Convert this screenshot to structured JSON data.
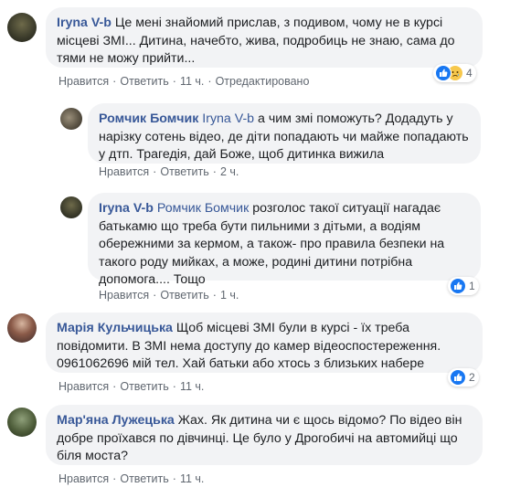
{
  "comments": [
    {
      "author": "Iryna V-b",
      "text": "Це мені знайомий прислав, з подивом, чому не в курсі місцеві ЗМІ... Дитина, начебто, жива, подробиць не знаю, сама до тями не можу прийти...",
      "actions": {
        "like": "Нравится",
        "reply": "Ответить",
        "time": "11 ч.",
        "edited": "Отредактировано"
      },
      "reaction_count": "4",
      "reactions": [
        "like-icon",
        "sad-icon"
      ]
    },
    {
      "author": "Ромчик Бомчик",
      "mention": "Iryna V-b",
      "text": "а чим змі поможуть? Додадуть у нарізку сотень відео, де діти попадають чи майже попадають у дтп. Трагедія, дай Боже, щоб дитинка вижила",
      "actions": {
        "like": "Нравится",
        "reply": "Ответить",
        "time": "2 ч."
      }
    },
    {
      "author": "Iryna V-b",
      "mention": "Ромчик Бомчик",
      "text": "розголос такої ситуації нагадає батькамю що треба бути пильними з дітьми, а водіям обережними за кермом, а також- про правила безпеки на такого роду мийках, а може, родині дитини потрібна допомога.... Тощо",
      "actions": {
        "like": "Нравится",
        "reply": "Ответить",
        "time": "1 ч."
      },
      "reaction_count": "1",
      "reactions": [
        "like-icon"
      ]
    },
    {
      "author": "Марія Кульчицька",
      "text": "Щоб місцеві ЗМІ були в курсі - їх треба повідомити. В ЗМІ нема доступу до камер відеоспостереження. 0961062696 мій тел. Хай батьки або хтось з близьких наберe",
      "actions": {
        "like": "Нравится",
        "reply": "Ответить",
        "time": "11 ч."
      },
      "reaction_count": "2",
      "reactions": [
        "like-icon"
      ]
    },
    {
      "author": "Мар'яна Лужецька",
      "text": "Жах. Як дитина чи є щось відомо? По відео він добре проїхався по дівчинці. Це було у Дрогобичі на автомийці що біля моста?",
      "actions": {
        "like": "Нравится",
        "reply": "Ответить",
        "time": "11 ч."
      }
    }
  ],
  "separator": "·",
  "colors": {
    "link": "#385898",
    "bubble": "#f2f3f5",
    "meta": "#606770",
    "like": "#1877f2"
  }
}
